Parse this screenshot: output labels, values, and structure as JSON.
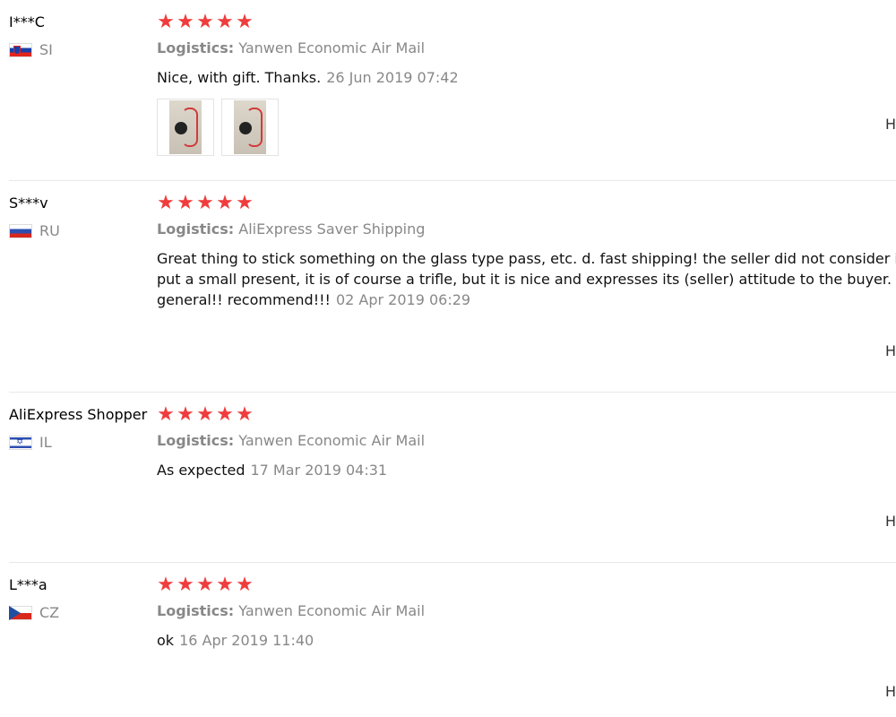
{
  "reviews": [
    {
      "user": "I***C",
      "country": "SI",
      "flag": "si",
      "stars": 5,
      "logistics_label": "Logistics:",
      "logistics": "Yanwen Economic Air Mail",
      "comment_lines": [
        "Nice, with gift. Thanks."
      ],
      "date": "26 Jun 2019 07:42",
      "photo_count": 2,
      "helpful_label": "H"
    },
    {
      "user": "S***v",
      "country": "RU",
      "flag": "ru",
      "stars": 5,
      "logistics_label": "Logistics:",
      "logistics": "AliExpress Saver Shipping",
      "comment_lines": [
        "Great thing to stick something on the glass type pass, etc. d. fast shipping! the seller did not consider it u",
        "put a small present, it is of course a trifle, but it is nice and expresses its (seller) attitude to the buyer. you",
        "general!! recommend!!!"
      ],
      "date": "02 Apr 2019 06:29",
      "photo_count": 0,
      "helpful_label": "H"
    },
    {
      "user": "AliExpress Shopper",
      "country": "IL",
      "flag": "il",
      "stars": 5,
      "logistics_label": "Logistics:",
      "logistics": "Yanwen Economic Air Mail",
      "comment_lines": [
        "As expected"
      ],
      "date": "17 Mar 2019 04:31",
      "photo_count": 0,
      "helpful_label": "H"
    },
    {
      "user": "L***a",
      "country": "CZ",
      "flag": "cz",
      "stars": 5,
      "logistics_label": "Logistics:",
      "logistics": "Yanwen Economic Air Mail",
      "comment_lines": [
        "ok"
      ],
      "date": "16 Apr 2019 11:40",
      "photo_count": 0,
      "helpful_label": "H"
    }
  ],
  "colors": {
    "star": "#f03c3c",
    "muted_text": "#888888",
    "divider": "#e8e8e8"
  }
}
